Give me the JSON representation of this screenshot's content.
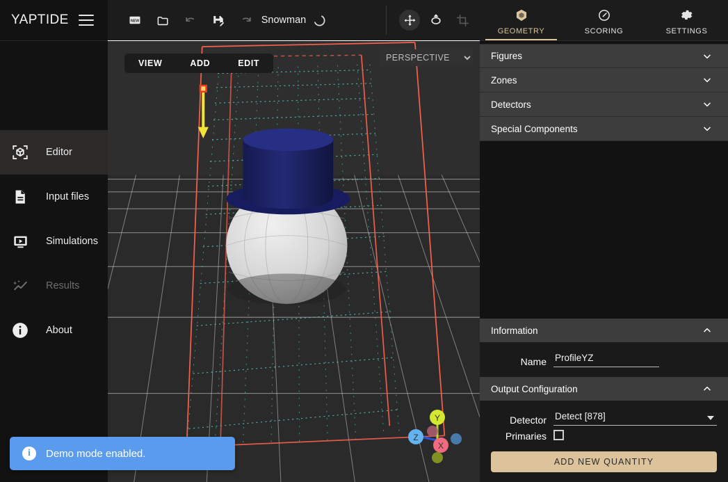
{
  "app": {
    "brand": "YAPTIDE",
    "document_title": "Snowman"
  },
  "toolbar": {
    "new_label": "NEW",
    "icons": [
      "new-file-icon",
      "open-folder-icon",
      "undo-icon",
      "save-as-icon",
      "redo-icon"
    ],
    "transform_icons": [
      "move-tool-icon",
      "rotate-tool-icon",
      "scale-tool-icon"
    ]
  },
  "tabs": [
    {
      "label": "GEOMETRY",
      "icon": "cube-icon",
      "active": true
    },
    {
      "label": "SCORING",
      "icon": "gauge-icon",
      "active": false
    },
    {
      "label": "SETTINGS",
      "icon": "gear-icon",
      "active": false
    }
  ],
  "sidebar": {
    "items": [
      {
        "label": "Editor",
        "icon": "editor-cube-icon",
        "active": true,
        "disabled": false
      },
      {
        "label": "Input files",
        "icon": "document-icon",
        "active": false,
        "disabled": false
      },
      {
        "label": "Simulations",
        "icon": "play-screen-icon",
        "active": false,
        "disabled": false
      },
      {
        "label": "Results",
        "icon": "sparkle-chart-icon",
        "active": false,
        "disabled": true
      },
      {
        "label": "About",
        "icon": "info-circle-icon",
        "active": false,
        "disabled": false
      }
    ]
  },
  "viewport": {
    "menu": [
      {
        "label": "VIEW"
      },
      {
        "label": "ADD"
      },
      {
        "label": "EDIT"
      }
    ],
    "camera_mode": "PERSPECTIVE",
    "camera_options": [
      "PERSPECTIVE"
    ],
    "axis_gizmo": {
      "x": "X",
      "y": "Y",
      "z": "Z"
    }
  },
  "geometry_panel": {
    "accordions": [
      {
        "label": "Figures",
        "expanded": false
      },
      {
        "label": "Zones",
        "expanded": false
      },
      {
        "label": "Detectors",
        "expanded": false
      },
      {
        "label": "Special Components",
        "expanded": false
      }
    ],
    "information": {
      "title": "Information",
      "expanded": true,
      "name_label": "Name",
      "name_value": "ProfileYZ",
      "name_placeholder": "Name"
    },
    "output_configuration": {
      "title": "Output Configuration",
      "expanded": true,
      "detector_label": "Detector",
      "detector_value": "Detect [878]",
      "detector_options": [
        "Detect [878]"
      ],
      "primaries_label": "Primaries",
      "primaries_checked": false,
      "add_quantity_label": "ADD NEW QUANTITY"
    }
  },
  "toast": {
    "message": "Demo mode enabled.",
    "icon": "info-circle-icon"
  },
  "colors": {
    "accent": "#dcc39b",
    "toast": "#5b9bed",
    "panel_header": "#3d3d3d",
    "viewport_bg": "#2e2e2e",
    "detector_box": "#f05c4a",
    "scoring_mesh": "#4ec8c0",
    "beam_arrow": "#f2e33a",
    "hat": "#1b1f62",
    "body": "#d8d8d8"
  }
}
